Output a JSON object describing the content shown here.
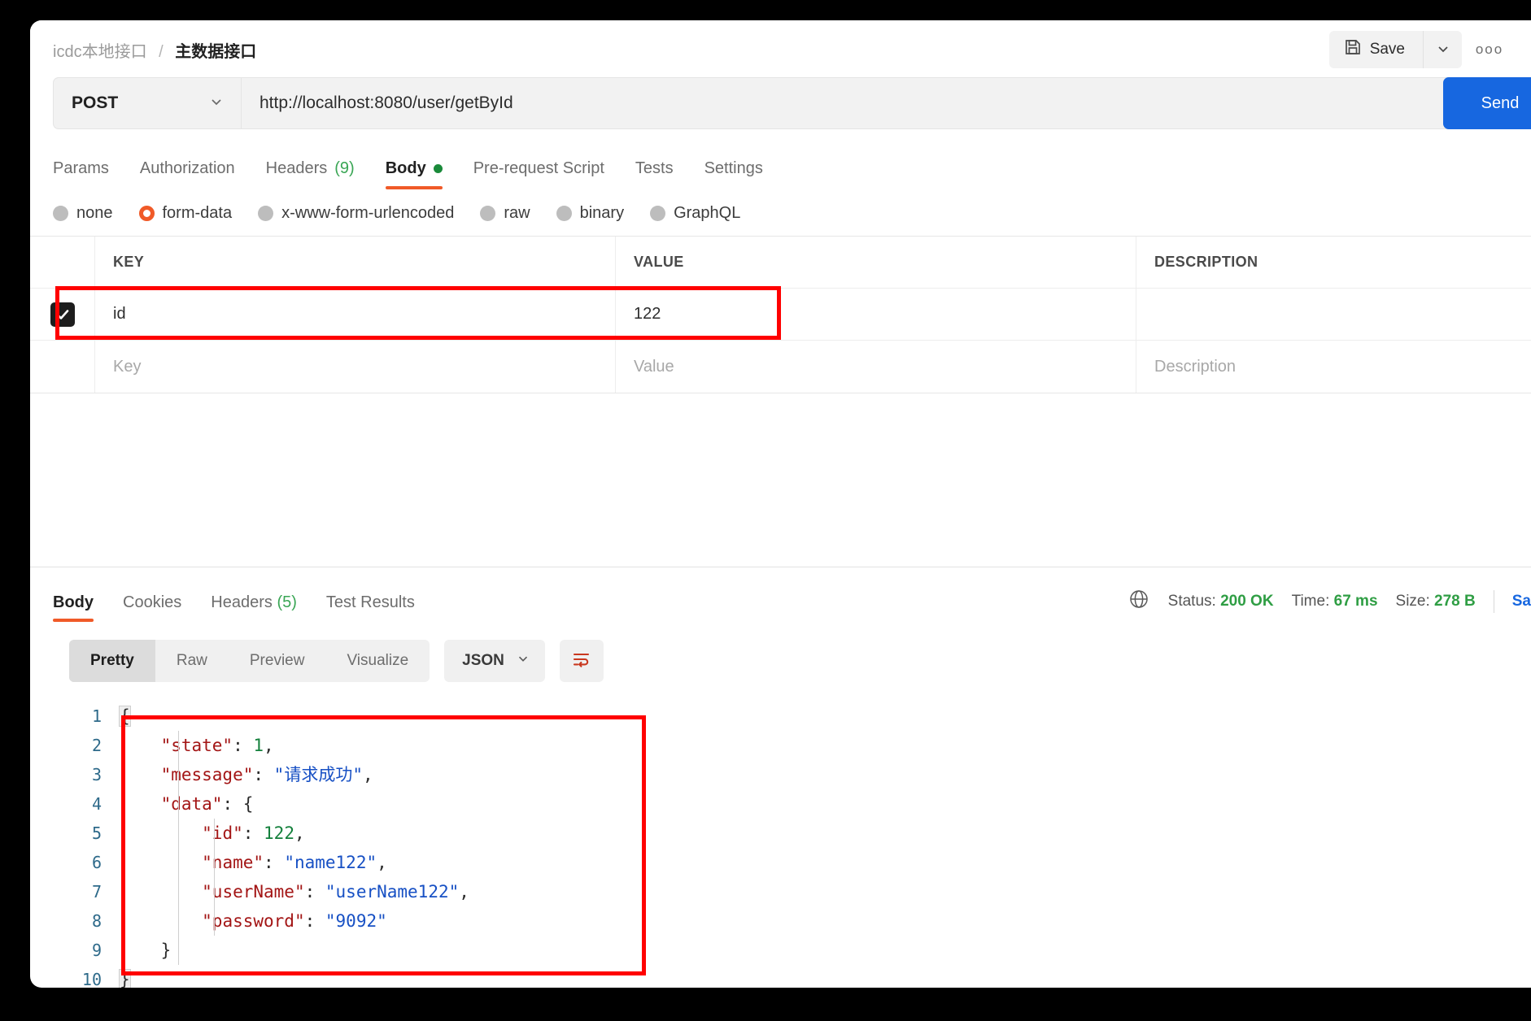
{
  "breadcrumb": {
    "parent": "icdc本地接口",
    "separator": "/",
    "current": "主数据接口"
  },
  "toolbar": {
    "save_label": "Save",
    "save_icon": "floppy-disk-icon",
    "caret_icon": "chevron-down-icon",
    "more_icon": "ellipsis-icon",
    "more_label": "ooo"
  },
  "request": {
    "method": "POST",
    "method_caret": "chevron-down-icon",
    "url": "http://localhost:8080/user/getById",
    "send_label": "Send",
    "tabs": [
      {
        "label": "Params",
        "active": false
      },
      {
        "label": "Authorization",
        "active": false
      },
      {
        "label": "Headers",
        "count": "(9)",
        "active": false
      },
      {
        "label": "Body",
        "active": true,
        "dot": true
      },
      {
        "label": "Pre-request Script",
        "active": false
      },
      {
        "label": "Tests",
        "active": false
      },
      {
        "label": "Settings",
        "active": false
      }
    ],
    "body_types": [
      {
        "label": "none",
        "selected": false
      },
      {
        "label": "form-data",
        "selected": true
      },
      {
        "label": "x-www-form-urlencoded",
        "selected": false
      },
      {
        "label": "raw",
        "selected": false
      },
      {
        "label": "binary",
        "selected": false
      },
      {
        "label": "GraphQL",
        "selected": false
      }
    ],
    "table": {
      "headers": {
        "key": "KEY",
        "value": "VALUE",
        "description": "DESCRIPTION"
      },
      "rows": [
        {
          "checked": true,
          "key": "id",
          "value": "122",
          "description": ""
        }
      ],
      "placeholder_row": {
        "key": "Key",
        "value": "Value",
        "description": "Description"
      }
    }
  },
  "response": {
    "tabs": [
      {
        "label": "Body",
        "active": true
      },
      {
        "label": "Cookies",
        "active": false
      },
      {
        "label": "Headers",
        "count": "(5)",
        "active": false
      },
      {
        "label": "Test Results",
        "active": false
      }
    ],
    "globe_icon": "globe-icon",
    "status_label": "Status:",
    "status_value": "200 OK",
    "time_label": "Time:",
    "time_value": "67 ms",
    "size_label": "Size:",
    "size_value": "278 B",
    "save_response_label": "Sa",
    "view_modes": [
      {
        "label": "Pretty",
        "active": true
      },
      {
        "label": "Raw",
        "active": false
      },
      {
        "label": "Preview",
        "active": false
      },
      {
        "label": "Visualize",
        "active": false
      }
    ],
    "format": "JSON",
    "format_caret": "chevron-down-icon",
    "wrap_icon": "word-wrap-icon",
    "code": {
      "lines": [
        {
          "n": "1",
          "text": "{"
        },
        {
          "n": "2",
          "text": "    \"state\": 1,"
        },
        {
          "n": "3",
          "text": "    \"message\": \"请求成功\","
        },
        {
          "n": "4",
          "text": "    \"data\": {"
        },
        {
          "n": "5",
          "text": "        \"id\": 122,"
        },
        {
          "n": "6",
          "text": "        \"name\": \"name122\","
        },
        {
          "n": "7",
          "text": "        \"userName\": \"userName122\","
        },
        {
          "n": "8",
          "text": "        \"password\": \"9092\""
        },
        {
          "n": "9",
          "text": "    }"
        },
        {
          "n": "10",
          "text": "}"
        }
      ]
    }
  },
  "annotations": {
    "color": "#ff0000",
    "boxes": [
      {
        "name": "form-data-row-highlight"
      },
      {
        "name": "response-data-highlight"
      }
    ]
  }
}
